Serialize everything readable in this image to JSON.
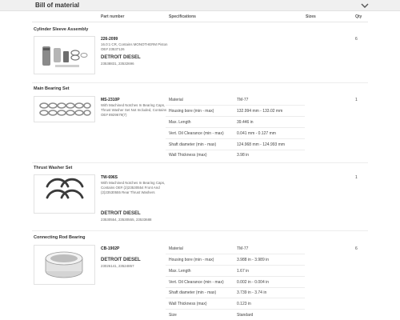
{
  "header": {
    "title": "Bill of material",
    "toggle_icon": "chevron-down-icon"
  },
  "columns": {
    "part_number": "Part number",
    "specifications": "Specifications",
    "sizes": "Sizes",
    "qty": "Qty"
  },
  "sections": [
    {
      "title": "Cylinder Sleeve Assembly",
      "part_number": "226-2099",
      "description": "16.0:1 CR, Contains MONOTHERM Piston OE# 23537126",
      "brand": "DETROIT DIESEL",
      "cross_refs": "23538831, 23532696",
      "qty": "6",
      "image_icon": "cylinder-sleeve-kit-icon",
      "specs": []
    },
    {
      "title": "Main Bearing Set",
      "part_number": "MS-2310P",
      "description": "With Machined Notches In Bearing Caps, Thrust Washer Set Not Included, Contains OE# 8929679(7)",
      "brand": "",
      "cross_refs": "",
      "qty": "1",
      "image_icon": "main-bearing-set-icon",
      "specs": [
        {
          "label": "Material",
          "value": "TM-77"
        },
        {
          "label": "Housing bore (min - max)",
          "value": "132.994 mm - 133.02 mm"
        },
        {
          "label": "Max. Length",
          "value": "39.446 in"
        },
        {
          "label": "Vert. Oil Clearance (min - max)",
          "value": "0.041 mm - 0.127 mm"
        },
        {
          "label": "Shaft diameter (min - max)",
          "value": "124.968 mm - 124.993 mm"
        },
        {
          "label": "Wall Thickness (max)",
          "value": "3.98 in"
        }
      ]
    },
    {
      "title": "Thrust Washer Set",
      "part_number": "TW-696S",
      "description": "With Machined Notches In Bearing Caps, Contains OE# (2)23530554 Front And (2)23530555 Rear Thrust Washers",
      "brand": "DETROIT DIESEL",
      "cross_refs": "23530554, 23530555, 23533688",
      "qty": "1",
      "image_icon": "thrust-washer-set-icon",
      "specs": []
    },
    {
      "title": "Connecting Rod Bearing",
      "part_number": "CB-1902P",
      "description": "",
      "brand": "DETROIT DIESEL",
      "cross_refs": "23026141, 23524857",
      "qty": "6",
      "image_icon": "connecting-rod-bearing-icon",
      "specs": [
        {
          "label": "Material",
          "value": "TM-77"
        },
        {
          "label": "Housing bore (min - max)",
          "value": "3.988 in - 3.989 in"
        },
        {
          "label": "Max. Length",
          "value": "1.67 in"
        },
        {
          "label": "Vert. Oil Clearance (min - max)",
          "value": "0.002 in - 0.004 in"
        },
        {
          "label": "Shaft diameter (min - max)",
          "value": "3.739 in - 3.74 in"
        },
        {
          "label": "Wall Thickness (max)",
          "value": "0.123 in"
        },
        {
          "label": "Size",
          "value": "Standard"
        }
      ]
    }
  ]
}
